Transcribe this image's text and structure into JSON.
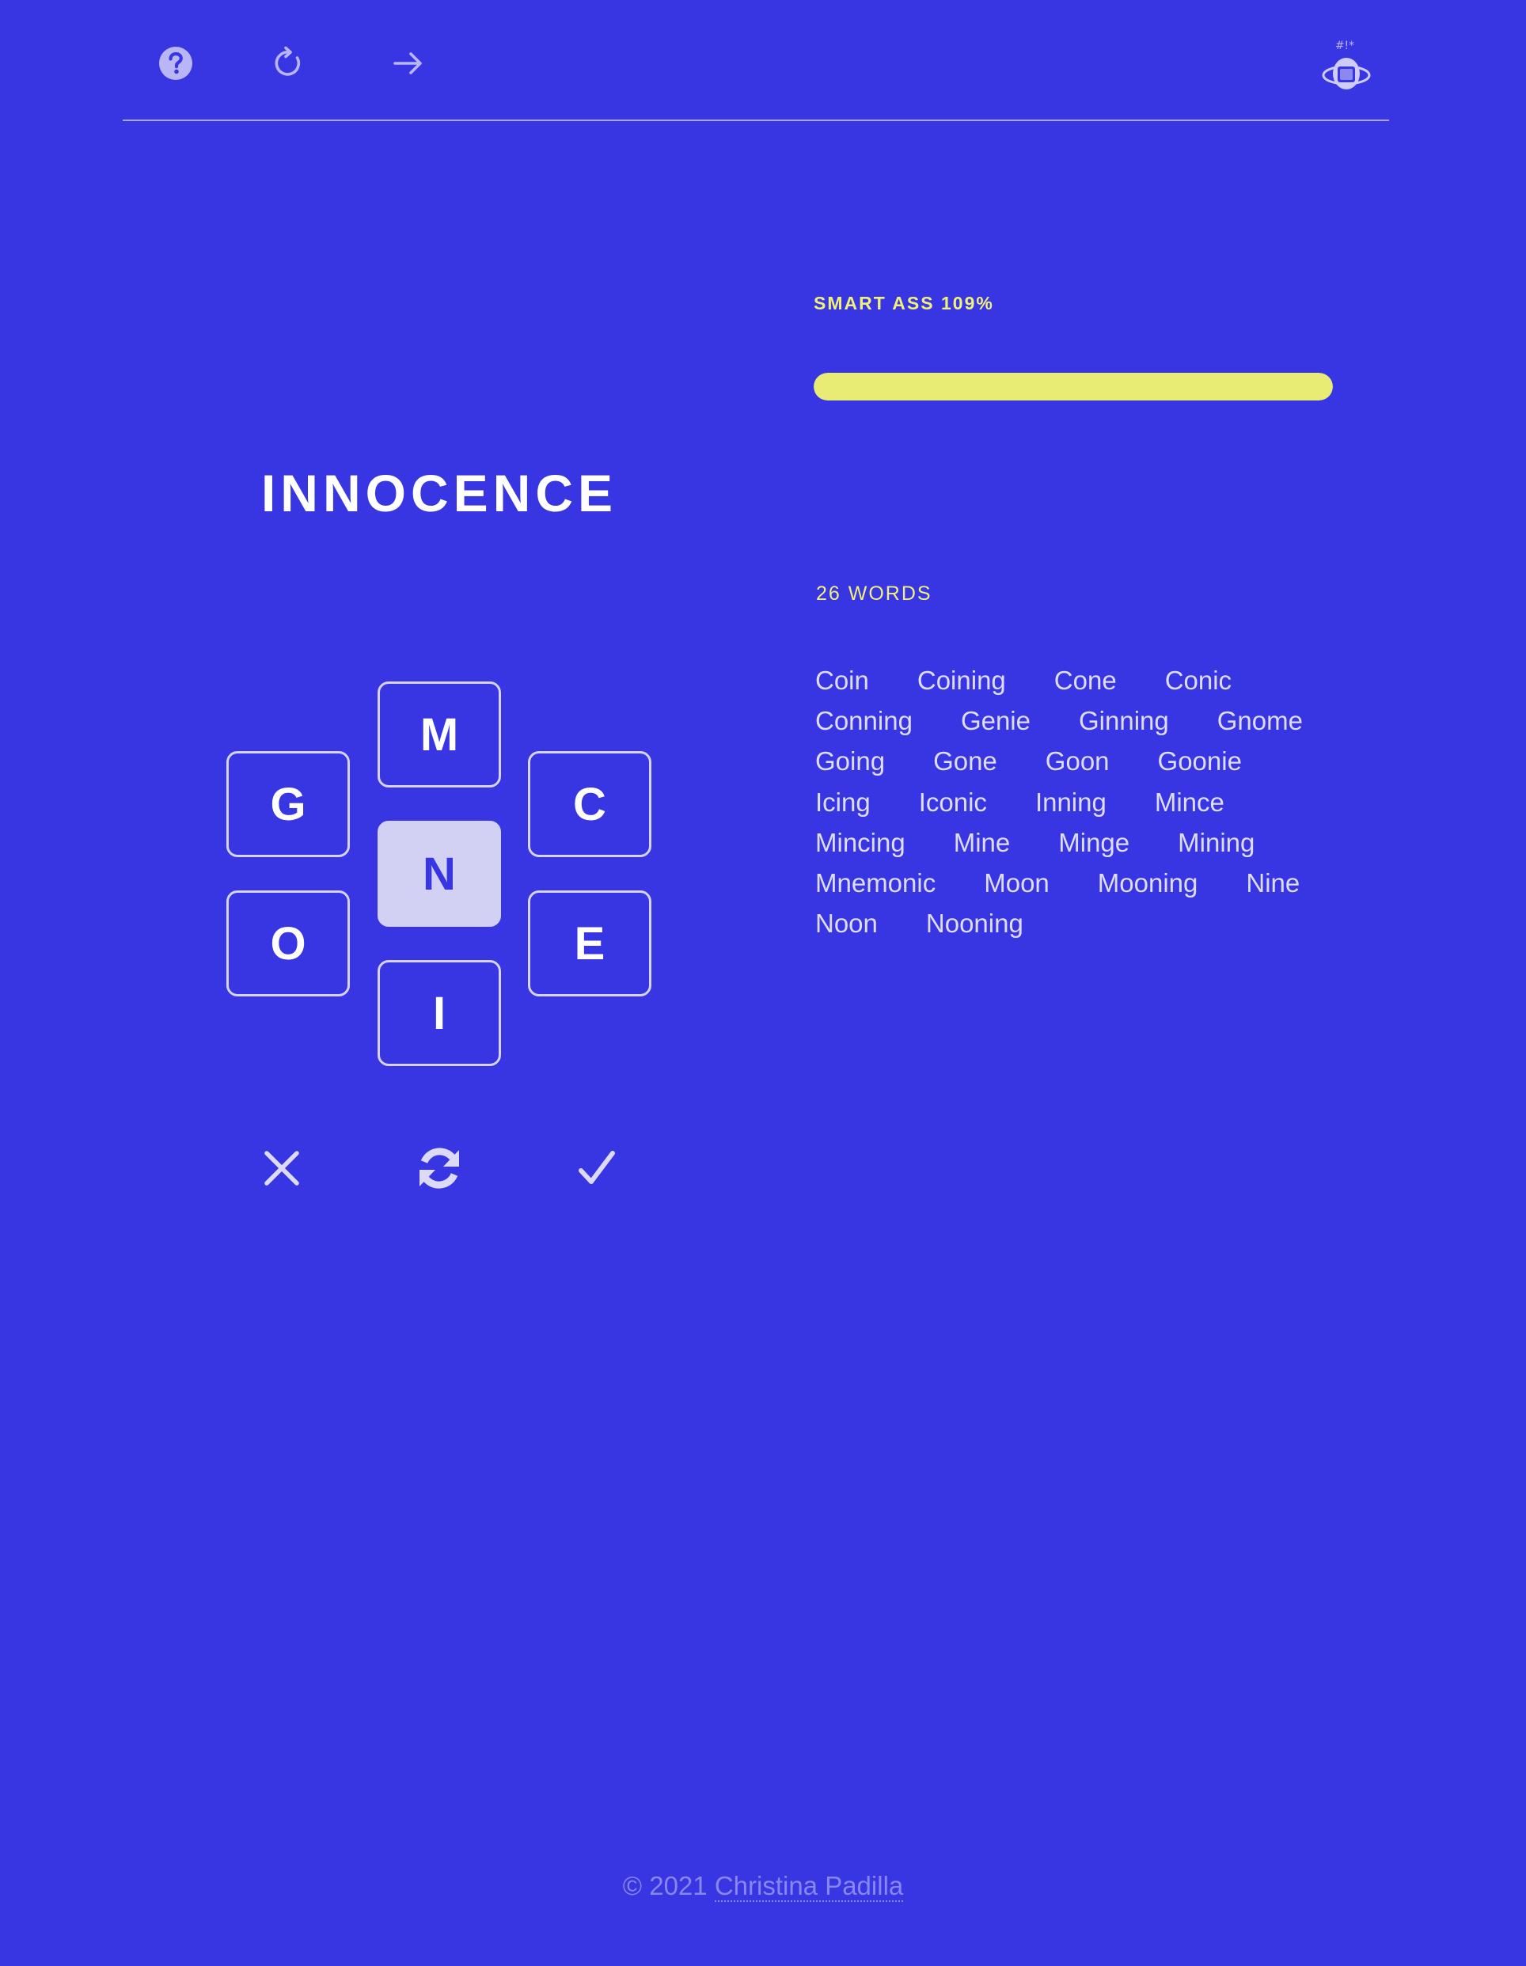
{
  "header": {
    "help_icon": "question-circle-icon",
    "new_game_icon": "rotate-clockwise-icon",
    "next_icon": "arrow-right-icon",
    "logo_icon": "astronaut-logo-icon",
    "logo_text": "#!*"
  },
  "game": {
    "current_word": "INNOCENCE",
    "center_letter": "N",
    "outer_letters": [
      "M",
      "G",
      "C",
      "O",
      "E",
      "I"
    ],
    "actions": {
      "delete_icon": "x-icon",
      "shuffle_icon": "shuffle-icon",
      "submit_icon": "check-icon"
    }
  },
  "score": {
    "rank_label": "SMART ASS 109%",
    "progress": 1.0,
    "progress_color": "#e8eb74"
  },
  "found_words": {
    "count_label": "26 WORDS",
    "words": [
      "Coin",
      "Coining",
      "Cone",
      "Conic",
      "Conning",
      "Genie",
      "Ginning",
      "Gnome",
      "Going",
      "Gone",
      "Goon",
      "Goonie",
      "Icing",
      "Iconic",
      "Inning",
      "Mince",
      "Mincing",
      "Mine",
      "Minge",
      "Mining",
      "Mnemonic",
      "Moon",
      "Mooning",
      "Nine",
      "Noon",
      "Nooning"
    ]
  },
  "footer": {
    "copyright": "© 2021 ",
    "author": "Christina Padilla"
  },
  "colors": {
    "background": "#3836e3",
    "accent": "#f0f07a",
    "tile_border": "#d7d3f5",
    "center_tile": "#d2d0f3"
  }
}
